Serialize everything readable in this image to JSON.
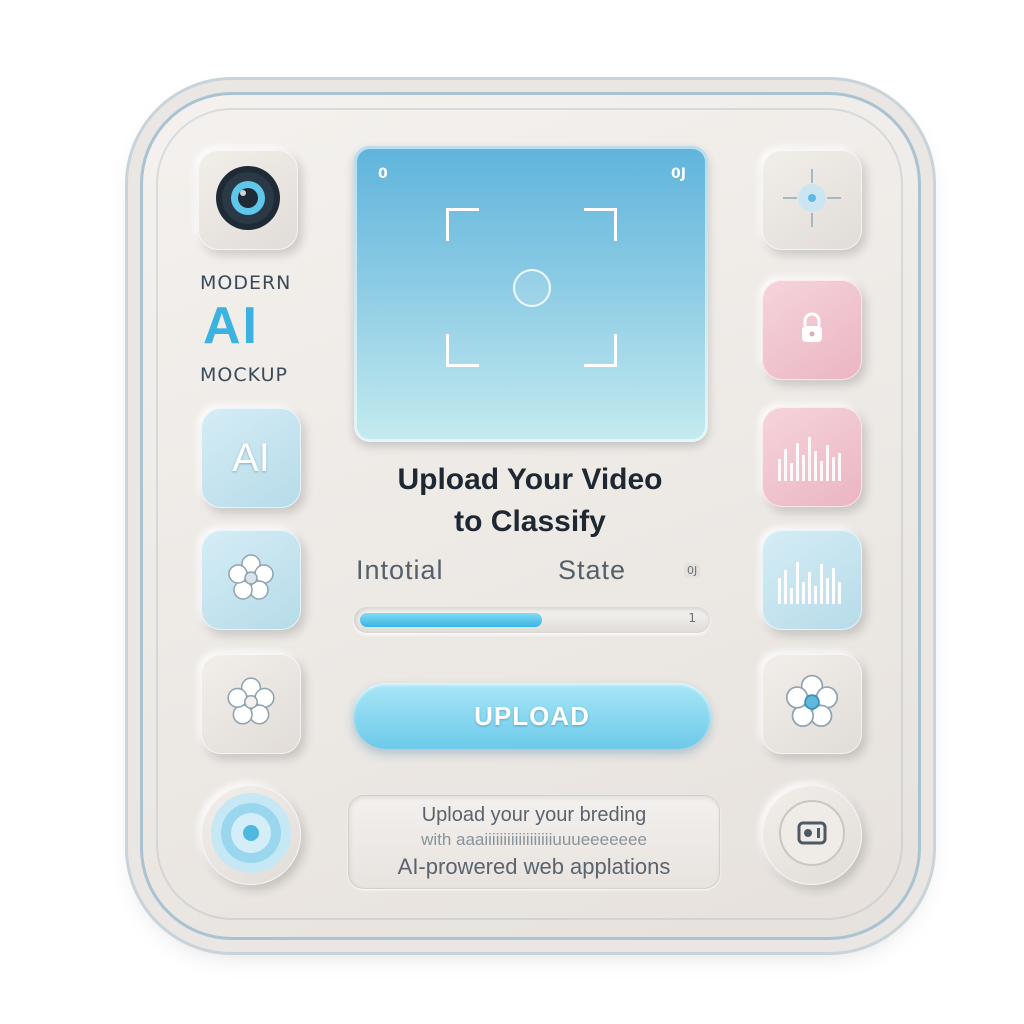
{
  "branding": {
    "line1": "MODERN",
    "line2": "AI",
    "line3": "MOCKUP"
  },
  "left_tiles": [
    {
      "name": "camera-lens-icon"
    },
    {
      "name": "ai-badge",
      "label": "AI"
    },
    {
      "name": "flower-icon"
    },
    {
      "name": "flower-icon"
    },
    {
      "name": "target-ring-icon"
    }
  ],
  "right_tiles": [
    {
      "name": "focus-crosshair-icon"
    },
    {
      "name": "lock-icon"
    },
    {
      "name": "bar-chart-icon"
    },
    {
      "name": "bar-chart-icon"
    },
    {
      "name": "flower-icon"
    },
    {
      "name": "video-icon"
    }
  ],
  "preview": {
    "top_left_badge": "0",
    "top_right_badge": "0J"
  },
  "heading": {
    "line1": "Upload Your Video",
    "line2": "to Classify"
  },
  "state": {
    "left": "Intotial",
    "right": "State",
    "badge": "0J"
  },
  "progress": {
    "value_percent": 53,
    "end_label": "1",
    "fill_color": "#3ab5e3"
  },
  "upload_button": {
    "label": "UPLOAD"
  },
  "description": {
    "line1": "Upload your your breding",
    "line2": "with aaaiiiiiiiiiiiiiiiiiiuuueeeeeee",
    "line3": "AI-prowered web applations"
  },
  "colors": {
    "accent": "#4fc0e8",
    "ai_text": "#3bb2e0",
    "pink_tile": "#eab5c1"
  }
}
